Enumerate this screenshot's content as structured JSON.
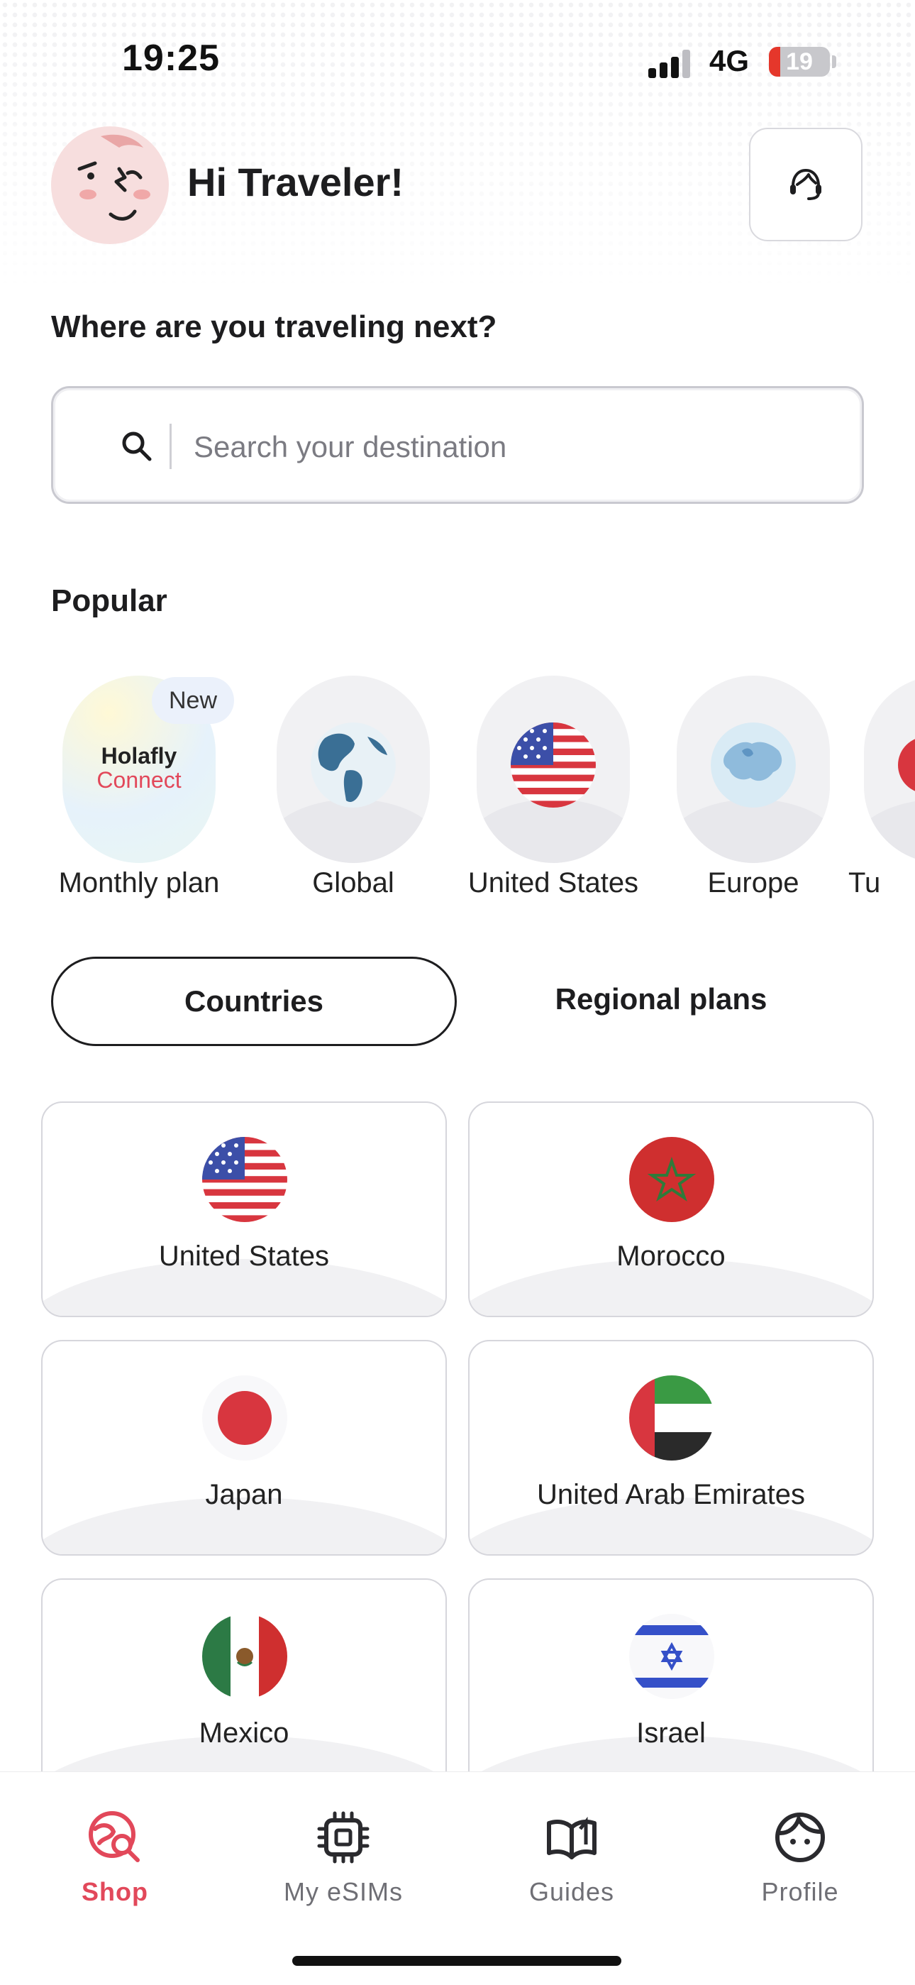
{
  "status_bar": {
    "time": "19:25",
    "network": "4G",
    "battery": "19"
  },
  "header": {
    "greeting": "Hi Traveler!",
    "avatar_icon": "face-avatar-icon",
    "support_icon": "headset-icon"
  },
  "search": {
    "question": "Where are you traveling next?",
    "placeholder": "Search your destination"
  },
  "popular": {
    "title": "Popular",
    "items": [
      {
        "label": "Monthly plan",
        "badge": "New",
        "logo_line1": "Holafly",
        "logo_line2": "Connect"
      },
      {
        "label": "Global",
        "icon": "globe-americas-icon"
      },
      {
        "label": "United States",
        "icon": "flag-us-icon"
      },
      {
        "label": "Europe",
        "icon": "globe-europe-icon"
      },
      {
        "label": "Tu"
      }
    ]
  },
  "tabs": {
    "countries": "Countries",
    "regional": "Regional plans",
    "active": "countries"
  },
  "countries": [
    {
      "name": "United States",
      "flag": "flag-us-icon"
    },
    {
      "name": "Morocco",
      "flag": "flag-morocco-icon"
    },
    {
      "name": "Japan",
      "flag": "flag-japan-icon"
    },
    {
      "name": "United Arab Emirates",
      "flag": "flag-uae-icon"
    },
    {
      "name": "Mexico",
      "flag": "flag-mexico-icon"
    },
    {
      "name": "Israel",
      "flag": "flag-israel-icon"
    }
  ],
  "tabbar": {
    "items": [
      {
        "label": "Shop",
        "icon": "shop-globe-icon",
        "active": true
      },
      {
        "label": "My eSIMs",
        "icon": "chip-icon",
        "active": false
      },
      {
        "label": "Guides",
        "icon": "book-icon",
        "active": false
      },
      {
        "label": "Profile",
        "icon": "profile-face-icon",
        "active": false
      }
    ]
  },
  "colors": {
    "accent": "#e2485a",
    "text": "#1d1d1f",
    "border": "#d6d6dc"
  }
}
